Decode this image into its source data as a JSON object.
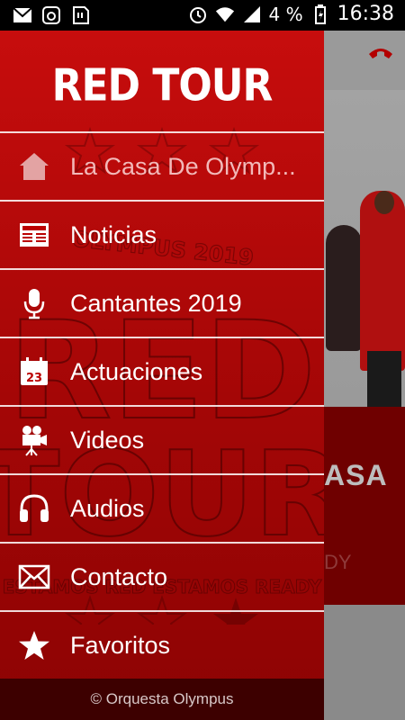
{
  "status_bar": {
    "icons_left": [
      "mail-icon",
      "camera-icon",
      "sd-card-icon"
    ],
    "battery": "4 %",
    "time": "16:38"
  },
  "drawer": {
    "title": "RED TOUR",
    "watermark": {
      "line1": "OLYMPUS 2019",
      "line2": "RED",
      "line3": "TOUR",
      "line4": "ESTAMOS RED ESTAMOS READY"
    },
    "items": [
      {
        "label": "La Casa De Olymp...",
        "icon": "home-icon",
        "selected": true
      },
      {
        "label": "Noticias",
        "icon": "newspaper-icon"
      },
      {
        "label": "Cantantes 2019",
        "icon": "microphone-icon"
      },
      {
        "label": "Actuaciones",
        "icon": "calendar-icon",
        "icon_text": "23"
      },
      {
        "label": "Videos",
        "icon": "video-camera-icon"
      },
      {
        "label": "Audios",
        "icon": "headphones-icon"
      },
      {
        "label": "Contacto",
        "icon": "mail-icon"
      },
      {
        "label": "Favoritos",
        "icon": "star-icon"
      }
    ],
    "footer": "© Orquesta Olympus"
  },
  "background_app": {
    "banner_text": "ASA",
    "banner_subtext": "DY"
  },
  "colors": {
    "drawer_top": "#c70d0d",
    "drawer_bottom": "#8d0303",
    "footer_bg": "#3d0000",
    "divider": "#ffffff"
  }
}
